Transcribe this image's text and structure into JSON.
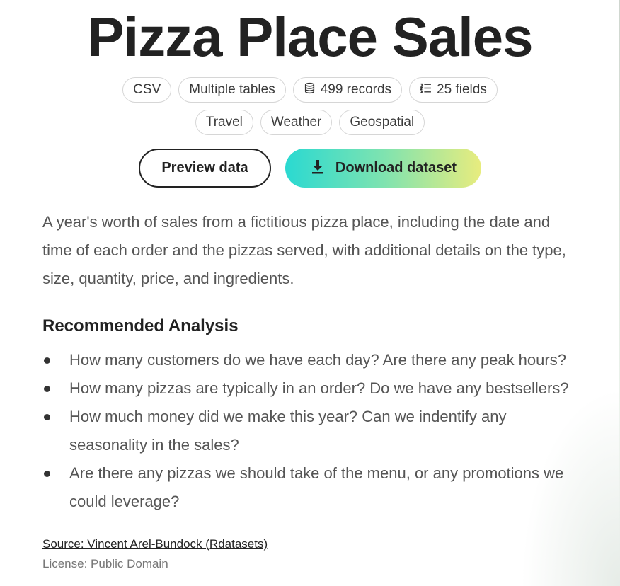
{
  "dataset": {
    "title": "Pizza Place Sales",
    "tags_row1": [
      {
        "label": "CSV",
        "icon": ""
      },
      {
        "label": "Multiple tables",
        "icon": ""
      },
      {
        "label": "499 records",
        "icon": "database-icon"
      },
      {
        "label": "25 fields",
        "icon": "list-icon"
      }
    ],
    "tags_row2": [
      {
        "label": "Travel"
      },
      {
        "label": "Weather"
      },
      {
        "label": "Geospatial"
      }
    ],
    "buttons": {
      "preview_label": "Preview data",
      "download_label": "Download dataset",
      "download_icon": "download-icon"
    },
    "description": "A year's worth of sales from a fictitious pizza place, including the date and time of each order and the pizzas served, with additional details on the type, size, quantity, price, and ingredients.",
    "analysis": {
      "heading": "Recommended Analysis",
      "items": [
        "How many customers do we have each day? Are there any peak hours?",
        "How many pizzas are typically in an order? Do we have any bestsellers?",
        "How much money did we make this year? Can we indentify any seasonality in the sales?",
        "Are there any pizzas we should take of the menu, or any promotions we could leverage?"
      ]
    },
    "source": "Source: Vincent Arel-Bundock (Rdatasets)",
    "license": "License: Public Domain"
  },
  "colors": {
    "title": "#222222",
    "body_text": "#555555",
    "gradient_start": "#2ad9d1",
    "gradient_end": "#e8ec7e"
  }
}
